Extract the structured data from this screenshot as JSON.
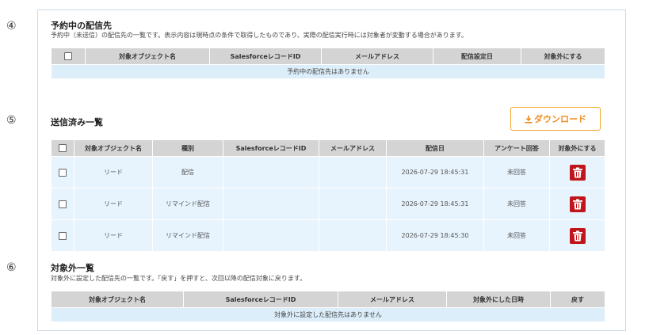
{
  "markers": {
    "m4": "④",
    "m5": "⑤",
    "m6": "⑥"
  },
  "reserved": {
    "title": "予約中の配信先",
    "desc": "予約中（未送信）の配信先の一覧です。表示内容は現時点の条件で取得したものであり、実際の配信実行時には対象者が変動する場合があります。",
    "headers": [
      "対象オブジェクト名",
      "SalesforceレコードID",
      "メールアドレス",
      "配信設定日",
      "対象外にする"
    ],
    "empty": "予約中の配信先はありません"
  },
  "sent": {
    "title": "送信済み一覧",
    "download_label": "ダウンロード",
    "headers": [
      "対象オブジェクト名",
      "種別",
      "SalesforceレコードID",
      "メールアドレス",
      "配信日",
      "アンケート回答",
      "対象外にする"
    ],
    "rows": [
      {
        "object": "リード",
        "type": "配信",
        "record_id": "",
        "email": "",
        "date": "2026-07-29 18:45:31",
        "survey": "未回答"
      },
      {
        "object": "リード",
        "type": "リマインド配信",
        "record_id": "",
        "email": "",
        "date": "2026-07-29 18:45:31",
        "survey": "未回答"
      },
      {
        "object": "リード",
        "type": "リマインド配信",
        "record_id": "",
        "email": "",
        "date": "2026-07-29 18:45:30",
        "survey": "未回答"
      }
    ]
  },
  "excluded": {
    "title": "対象外一覧",
    "desc": "対象外に設定した配信先の一覧です。「戻す」を押すと、次回以降の配信対象に戻ります。",
    "headers": [
      "対象オブジェクト名",
      "SalesforceレコードID",
      "メールアドレス",
      "対象外にした日時",
      "戻す"
    ],
    "empty": "対象外に設定した配信先はありません"
  },
  "colors": {
    "accent": "#ef8c1e",
    "delete": "#c0161b",
    "header_bg": "#d4d4d4",
    "row_bg": "#e8f4fd"
  },
  "icons": {
    "download": "download-icon",
    "trash": "trash-icon"
  }
}
